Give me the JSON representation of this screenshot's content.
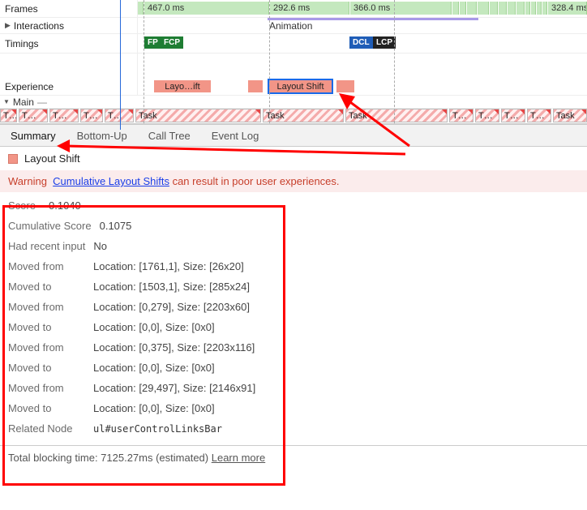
{
  "rows": {
    "frames": {
      "label": "Frames",
      "segments": [
        "467.0 ms",
        "292.6 ms",
        "366.0 ms",
        "328.4 ms"
      ]
    },
    "interactions": {
      "label": "Interactions",
      "animation": "Animation"
    },
    "timings": {
      "label": "Timings",
      "badges": {
        "fp": "FP",
        "fcp": "FCP",
        "dcl": "DCL",
        "lcp": "LCP"
      }
    },
    "experience": {
      "label": "Experience",
      "shifts": {
        "first": "Layo…ift",
        "selected": "Layout Shift"
      }
    },
    "main": {
      "label": "Main",
      "dash": "—",
      "task_short": "T…",
      "task_long": "Task"
    }
  },
  "tabs": {
    "summary": "Summary",
    "bottomup": "Bottom-Up",
    "calltree": "Call Tree",
    "eventlog": "Event Log"
  },
  "summary": {
    "title": "Layout Shift",
    "warning_label": "Warning",
    "warning_link": "Cumulative Layout Shifts",
    "warning_tail": " can result in poor user experiences.",
    "rows": [
      {
        "key": "Score",
        "val": "0.1040",
        "short": true
      },
      {
        "key": "Cumulative Score",
        "val": "0.1075"
      },
      {
        "key": "Had recent input",
        "val": "No"
      },
      {
        "key": "Moved from",
        "val": "Location: [1761,1], Size: [26x20]"
      },
      {
        "key": "Moved to",
        "val": "Location: [1503,1], Size: [285x24]"
      },
      {
        "key": "Moved from",
        "val": "Location: [0,279], Size: [2203x60]"
      },
      {
        "key": "Moved to",
        "val": "Location: [0,0], Size: [0x0]"
      },
      {
        "key": "Moved from",
        "val": "Location: [0,375], Size: [2203x116]"
      },
      {
        "key": "Moved to",
        "val": "Location: [0,0], Size: [0x0]"
      },
      {
        "key": "Moved from",
        "val": "Location: [29,497], Size: [2146x91]"
      },
      {
        "key": "Moved to",
        "val": "Location: [0,0], Size: [0x0]"
      },
      {
        "key": "Related Node",
        "val": "ul#userControlLinksBar",
        "mono": true
      }
    ]
  },
  "footer": {
    "text": "Total blocking time: 7125.27ms (estimated) ",
    "learn": "Learn more"
  }
}
